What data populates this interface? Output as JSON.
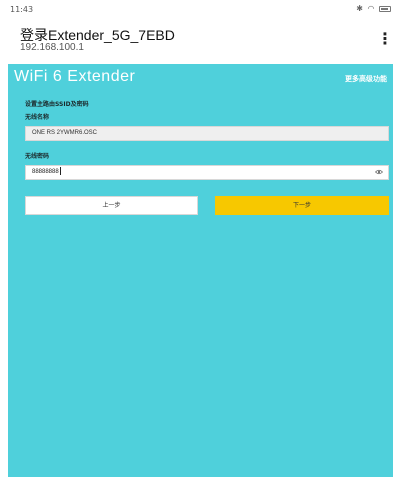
{
  "status_bar": {
    "time": "11:43",
    "icons": [
      "bluetooth-icon",
      "wifi-icon",
      "battery-icon"
    ]
  },
  "header": {
    "title": "登录Extender_5G_7EBD",
    "subtitle": "192.168.100.1"
  },
  "page": {
    "brand": "WiFi 6 Extender",
    "more_link": "更多高级功能",
    "section_title": "设置主路由SSID及密码",
    "ssid_label": "无线名称",
    "ssid_value": "ONE RS 2YWMR6.OSC",
    "password_label": "无线密码",
    "password_value": "88888888",
    "prev_button": "上一步",
    "next_button": "下一步"
  },
  "colors": {
    "background": "#4fd0db",
    "next_button": "#f7c800"
  }
}
